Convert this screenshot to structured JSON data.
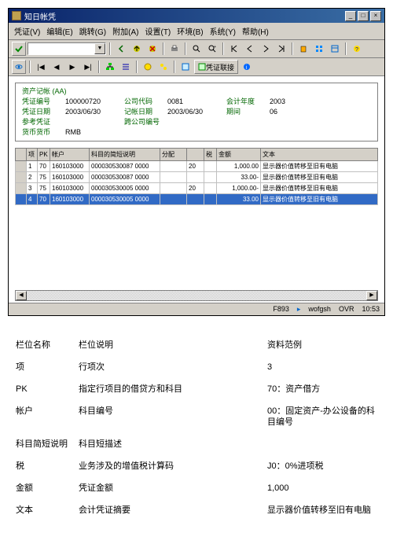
{
  "window": {
    "title": "知日帐凭",
    "btn_min": "_",
    "btn_max": "□",
    "btn_close": "×"
  },
  "menu": {
    "items": [
      "凭证(V)",
      "编辑(E)",
      "跳转(G)",
      "附加(A)",
      "设置(T)",
      "环境(B)",
      "系统(Y)",
      "帮助(H)"
    ]
  },
  "toolbar": {
    "dropdown_arrow": "▼",
    "nav_first": "|◀",
    "nav_prev": "◀",
    "nav_next": "▶",
    "nav_last": "▶|",
    "link_label": "凭证联接"
  },
  "header": {
    "section_title": "资产记帐 (AA)",
    "rows": [
      {
        "l1": "凭证编号",
        "v1": "100000720",
        "l2": "公司代码",
        "v2": "0081",
        "l3": "会计年度",
        "v3": "2003"
      },
      {
        "l1": "凭证日期",
        "v1": "2003/06/30",
        "l2": "记帐日期",
        "v2": "2003/06/30",
        "l3": "期间",
        "v3": "06"
      },
      {
        "l1": "参考凭证",
        "v1": "",
        "l2": "跨公司编号",
        "v2": "",
        "l3": "",
        "v3": ""
      },
      {
        "l1": "货币货币",
        "v1": "RMB",
        "l2": "",
        "v2": "",
        "l3": "",
        "v3": ""
      }
    ]
  },
  "grid": {
    "headers": [
      "项",
      "PK",
      "帐户",
      "科目的简短说明",
      "分配",
      "",
      "税",
      "金额",
      "文本"
    ],
    "rows": [
      {
        "r": "1",
        "pk": "70",
        "acct": "160103000",
        "desc": "000030530087 0000",
        "assign": "",
        "blank": "20",
        "tax": "",
        "amt": "1,000.00",
        "text": "显示器价值转移至旧有电脑"
      },
      {
        "r": "2",
        "pk": "75",
        "acct": "160103000",
        "desc": "000030530087 0000",
        "assign": "",
        "blank": "",
        "tax": "",
        "amt": "33.00-",
        "text": "显示器价值转移至旧有电脑"
      },
      {
        "r": "3",
        "pk": "75",
        "acct": "160103000",
        "desc": "000030530005 0000",
        "assign": "",
        "blank": "20",
        "tax": "",
        "amt": "1,000.00-",
        "text": "显示器价值转移至旧有电脑"
      },
      {
        "r": "4",
        "pk": "70",
        "acct": "160103000",
        "desc": "000030530005 0000",
        "assign": "",
        "blank": "",
        "tax": "",
        "amt": "33.00",
        "text": "显示器价值转移至旧有电脑"
      }
    ]
  },
  "statusbar": {
    "f1": "F893",
    "f2": "wofgsh",
    "f3": "OVR",
    "f4": "10:53"
  },
  "doc": {
    "header": {
      "c1": "栏位名称",
      "c2": "栏位说明",
      "c3": "资料范例"
    },
    "rows": [
      {
        "c1": "项",
        "c2": "行项次",
        "c3": "3"
      },
      {
        "c1": "PK",
        "c2": "指定行项目的借贷方和科目",
        "c3": "70：资产借方"
      },
      {
        "c1": "帐户",
        "c2": "科目编号",
        "c3": "00：固定资产-办公设备的科目编号"
      },
      {
        "c1": "科目简短说明",
        "c2": "科目短描述",
        "c3": ""
      },
      {
        "c1": "税",
        "c2": "业务涉及的增值税计算码",
        "c3": "J0：0%进项税"
      },
      {
        "c1": "金额",
        "c2": "凭证金额",
        "c3": "1,000"
      },
      {
        "c1": "文本",
        "c2": "会计凭证摘要",
        "c3": "显示器价值转移至旧有电脑"
      }
    ]
  }
}
